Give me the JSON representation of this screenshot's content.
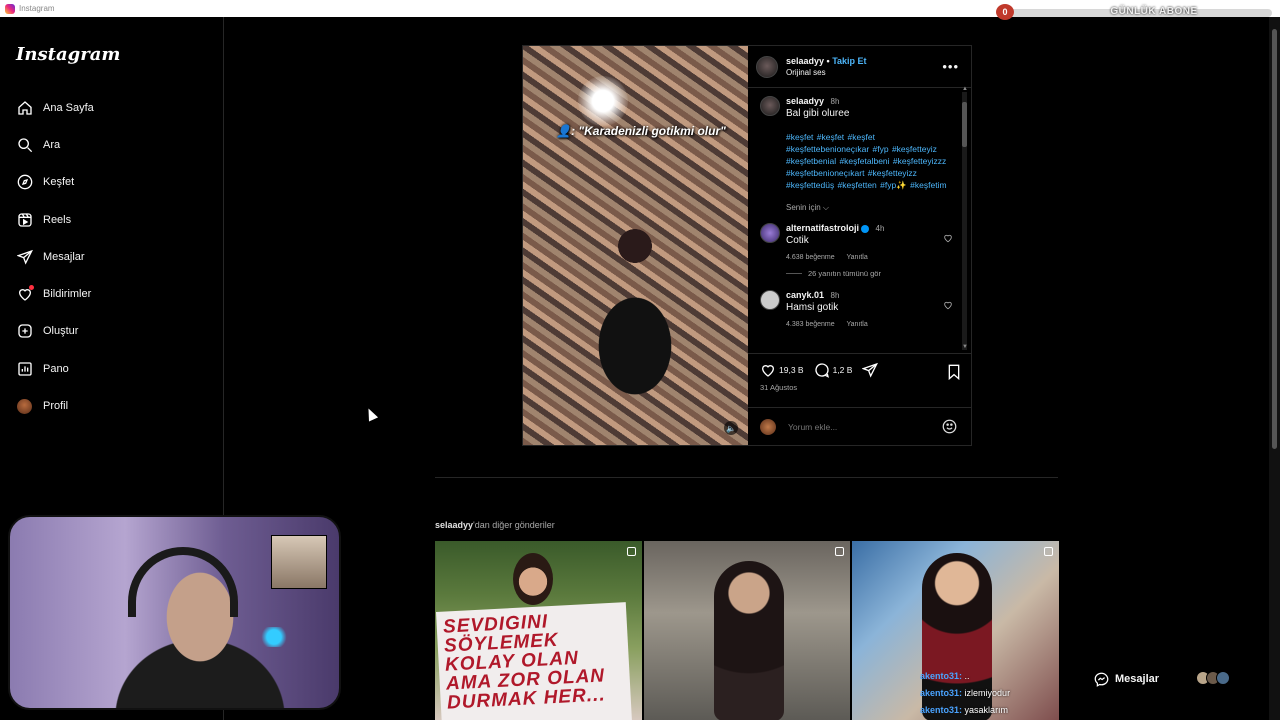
{
  "window": {
    "title": "Instagram"
  },
  "overlay": {
    "sub_count": "0",
    "sub_label": "GÜNLÜK ABONE"
  },
  "sidebar": {
    "logo": "Instagram",
    "items": [
      {
        "label": "Ana Sayfa",
        "icon": "home-icon"
      },
      {
        "label": "Ara",
        "icon": "search-icon"
      },
      {
        "label": "Keşfet",
        "icon": "compass-icon"
      },
      {
        "label": "Reels",
        "icon": "reels-icon"
      },
      {
        "label": "Mesajlar",
        "icon": "send-icon"
      },
      {
        "label": "Bildirimler",
        "icon": "heart-icon"
      },
      {
        "label": "Oluştur",
        "icon": "plus-square-icon"
      },
      {
        "label": "Pano",
        "icon": "chart-icon"
      },
      {
        "label": "Profil",
        "icon": "avatar-icon"
      }
    ]
  },
  "post": {
    "media_caption": "👤: \"Karadenizli gotikmi olur\"",
    "username": "selaadyy",
    "follow_label": "Takip Et",
    "separator": "•",
    "audio": "Orijinal ses",
    "more": "•••",
    "caption": {
      "user": "selaadyy",
      "time": "8h",
      "text": "Bal gibi oluree",
      "tags": "#keşfet #keşfet #keşfet #keşfettebenioneçıkar #fyp #keşfetteyiz #keşfetbenial #keşfetalbeni #keşfetteyizzz #keşfetbenioneçıkart #keşfetteyizz #keşfettedüş #keşfetten #fyp✨ #keşfetim"
    },
    "for_you": "Senin için ⌵",
    "comments": [
      {
        "user": "alternatifastroloji",
        "verified": true,
        "time": "4h",
        "text": "Cotik",
        "likes": "4.638 beğenme",
        "reply": "Yanıtla",
        "replies": "26 yanıtın tümünü gör"
      },
      {
        "user": "canyk.01",
        "verified": false,
        "time": "8h",
        "text": "Hamsi gotik",
        "likes": "4.383 beğenme",
        "reply": "Yanıtla"
      }
    ],
    "likes": "19,3 B",
    "comments_count": "1,2 B",
    "date": "31 Ağustos",
    "add_comment_placeholder": "Yorum ekle..."
  },
  "more_posts": {
    "user": "selaadyy",
    "suffix": "'dan diğer gönderiler",
    "sign_text": "SEVDIGINI SÖYLEMEK KOLAY OLAN AMA ZOR OLAN DURMAK HER..."
  },
  "chat": [
    {
      "user": "akento31:",
      "msg": ".."
    },
    {
      "user": "akento31:",
      "msg": "izlemiyodur"
    },
    {
      "user": "akento31:",
      "msg": "yasaklarım"
    }
  ],
  "messages_pill": {
    "label": "Mesajlar"
  },
  "colors": {
    "accent": "#4cb5f9",
    "like": "#ff3040",
    "bg": "#000000",
    "border": "#262626"
  }
}
